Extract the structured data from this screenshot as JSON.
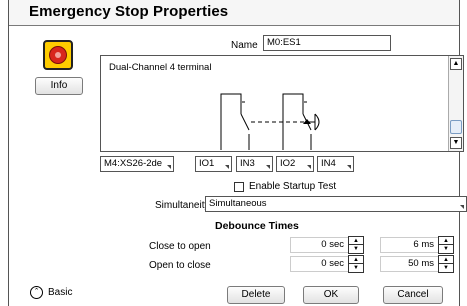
{
  "dialog": {
    "title": "Emergency Stop Properties",
    "info_label": "Info",
    "stop_icon": "emergency-stop-icon"
  },
  "name": {
    "label": "Name",
    "value": "M0:ES1"
  },
  "description": {
    "text": "Dual-Channel 4 terminal"
  },
  "terminals": {
    "module": "M4:XS26-2de",
    "inputs": [
      "IO1",
      "IN3",
      "IO2",
      "IN4"
    ]
  },
  "startup_test": {
    "label": "Enable Startup Test",
    "checked": false
  },
  "simultaneity": {
    "label": "Simultaneity",
    "value": "Simultaneous"
  },
  "debounce": {
    "title": "Debounce Times",
    "rows": [
      {
        "label": "Close to open",
        "value1": "0 sec",
        "value2": "6 ms"
      },
      {
        "label": "Open to close",
        "value1": "0 sec",
        "value2": "50 ms"
      }
    ]
  },
  "footer": {
    "basic_label": "Basic",
    "delete_label": "Delete",
    "ok_label": "OK",
    "cancel_label": "Cancel"
  }
}
